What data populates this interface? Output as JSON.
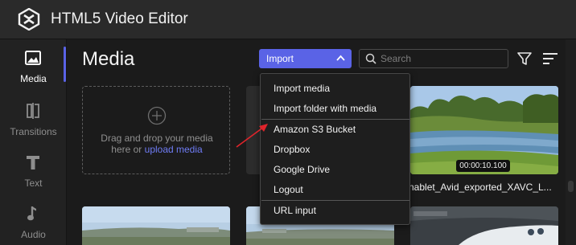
{
  "app": {
    "title": "HTML5 Video Editor"
  },
  "sidebar": {
    "items": [
      {
        "label": "Media",
        "icon": "image-icon",
        "active": true
      },
      {
        "label": "Transitions",
        "icon": "transitions-icon",
        "active": false
      },
      {
        "label": "Text",
        "icon": "text-icon",
        "active": false
      },
      {
        "label": "Audio",
        "icon": "music-note-icon",
        "active": false
      }
    ]
  },
  "main": {
    "heading": "Media",
    "import_label": "Import",
    "search": {
      "placeholder": "Search",
      "value": ""
    },
    "dropzone": {
      "line1": "Drag and drop your media",
      "line2_prefix": "here or ",
      "link_label": "upload media"
    },
    "clips": [
      {
        "duration": "00:00:10.100",
        "name": "nablet_Avid_exported_XAVC_L..."
      }
    ]
  },
  "import_menu": {
    "items": [
      "Import media",
      "Import folder with media",
      "Amazon S3 Bucket",
      "Dropbox",
      "Google Drive",
      "Logout",
      "URL input"
    ]
  },
  "colors": {
    "accent": "#5a63e6",
    "link": "#6f7cf5",
    "annotation_arrow": "#e0242b"
  }
}
